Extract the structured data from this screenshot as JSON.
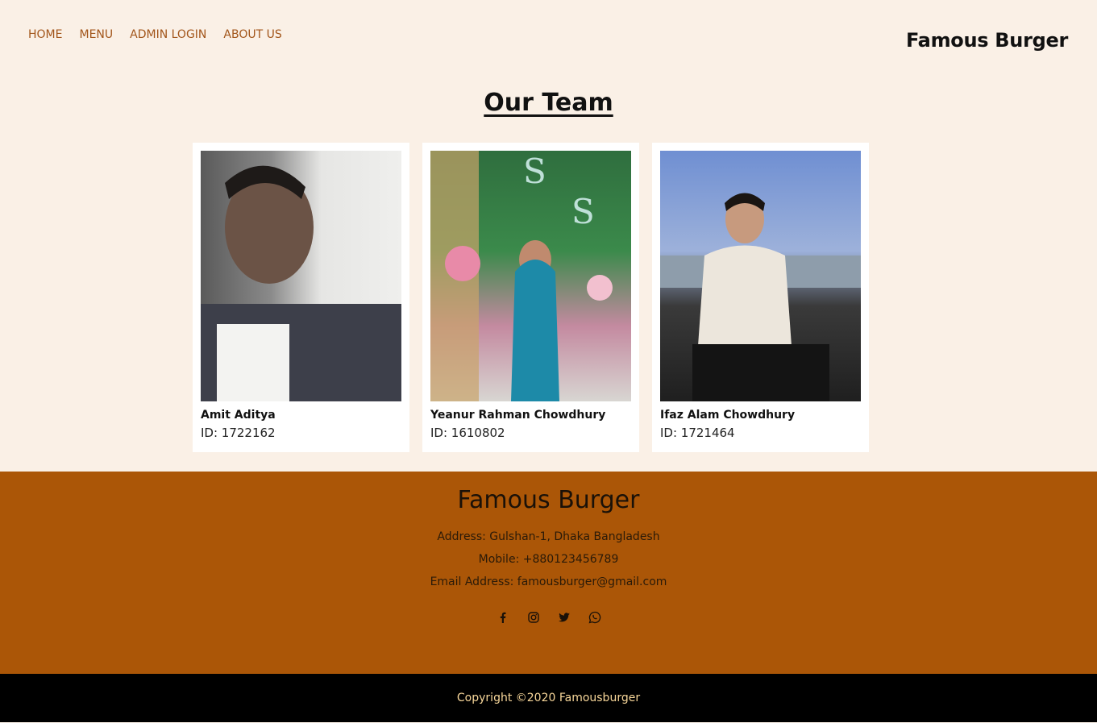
{
  "nav": {
    "items": [
      {
        "label": "HOME"
      },
      {
        "label": "MENU"
      },
      {
        "label": "ADMIN LOGIN"
      },
      {
        "label": "ABOUT US"
      }
    ]
  },
  "header": {
    "brand": "Famous Burger"
  },
  "main": {
    "title": "Our Team",
    "members": [
      {
        "name": "Amit Aditya",
        "id": "ID: 1722162"
      },
      {
        "name": "Yeanur Rahman Chowdhury",
        "id": "ID: 1610802"
      },
      {
        "name": "Ifaz Alam Chowdhury",
        "id": "ID: 1721464"
      }
    ]
  },
  "footer": {
    "title": "Famous Burger",
    "address": "Address: Gulshan-1, Dhaka Bangladesh",
    "mobile": "Mobile: +880123456789",
    "email": "Email Address: famousburger@gmail.com",
    "socials": [
      "facebook-icon",
      "instagram-icon",
      "twitter-icon",
      "whatsapp-icon"
    ],
    "copyright": "Copyright ©2020 Famousburger"
  },
  "colors": {
    "page_bg": "#faf0e6",
    "nav_link": "#a2551a",
    "footer_bg": "#ab5607",
    "copyright_bg": "#000000",
    "copyright_text": "#f8d79a"
  }
}
